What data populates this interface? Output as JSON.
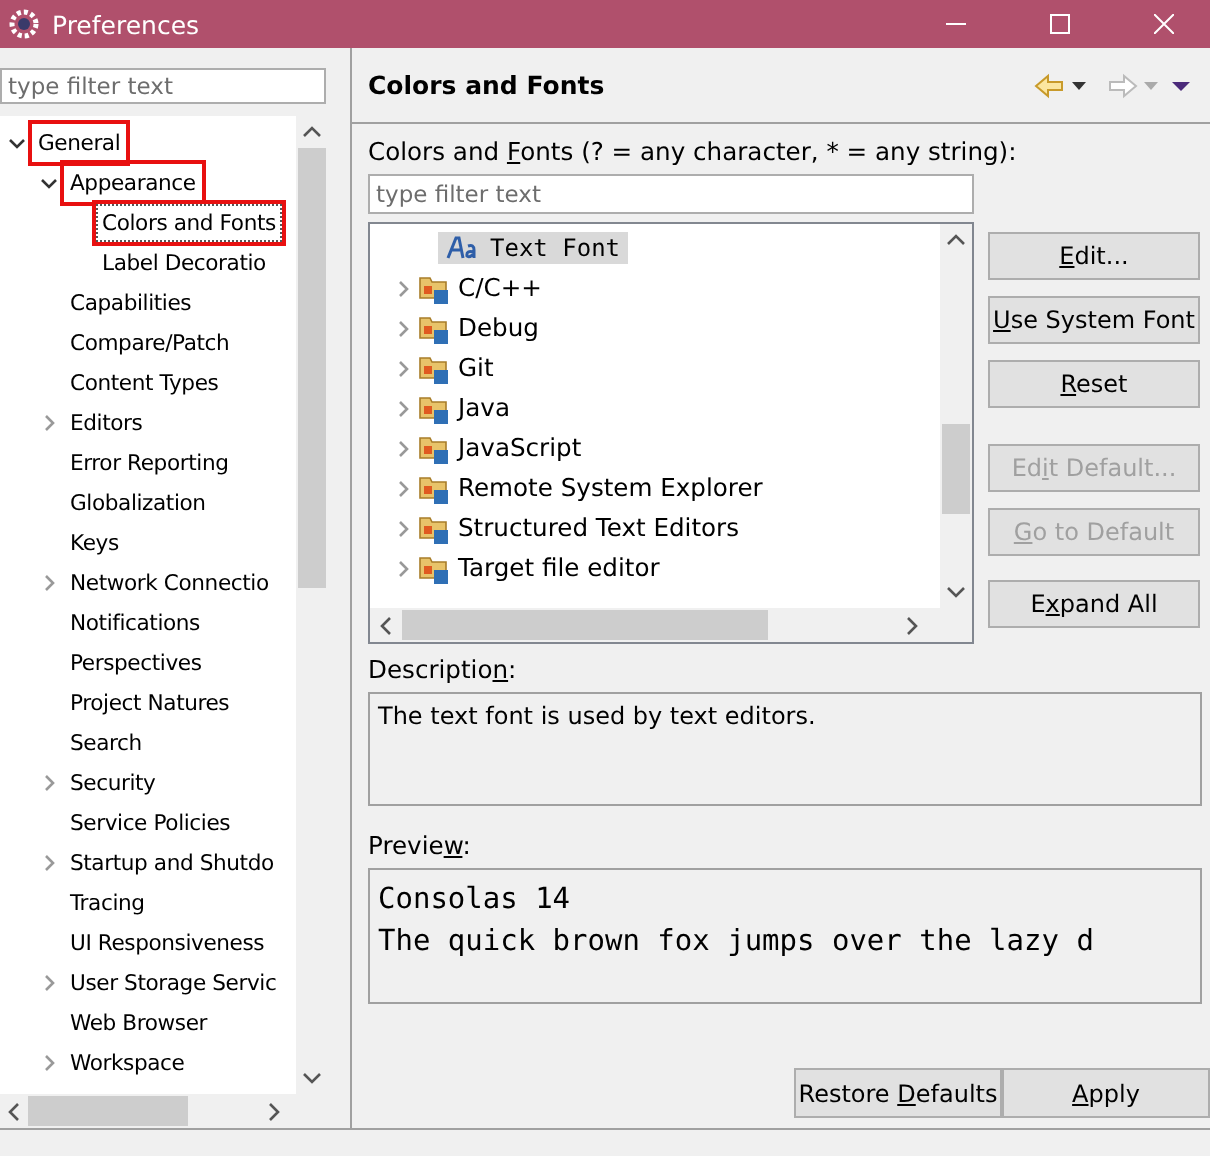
{
  "window": {
    "title": "Preferences"
  },
  "left_filter": {
    "placeholder": "type filter text"
  },
  "tree": [
    {
      "label": "General",
      "kind": "folder",
      "expanded": true,
      "selected": false,
      "annotated": true,
      "children": [
        {
          "label": "Appearance",
          "kind": "folder",
          "expanded": true,
          "selected": false,
          "annotated": true,
          "children": [
            {
              "label": "Colors and Fonts",
              "kind": "leaf",
              "selected": true,
              "annotated": true
            },
            {
              "label": "Label Decoratio",
              "kind": "leaf",
              "selected": false,
              "annotated": false
            }
          ]
        },
        {
          "label": "Capabilities",
          "kind": "leaf",
          "selected": false,
          "annotated": false
        },
        {
          "label": "Compare/Patch",
          "kind": "leaf",
          "selected": false,
          "annotated": false
        },
        {
          "label": "Content Types",
          "kind": "leaf",
          "selected": false,
          "annotated": false
        },
        {
          "label": "Editors",
          "kind": "folder",
          "expanded": false,
          "selected": false,
          "annotated": false
        },
        {
          "label": "Error Reporting",
          "kind": "leaf",
          "selected": false,
          "annotated": false
        },
        {
          "label": "Globalization",
          "kind": "leaf",
          "selected": false,
          "annotated": false
        },
        {
          "label": "Keys",
          "kind": "leaf",
          "selected": false,
          "annotated": false
        },
        {
          "label": "Network Connectio",
          "kind": "folder",
          "expanded": false,
          "selected": false,
          "annotated": false
        },
        {
          "label": "Notifications",
          "kind": "leaf",
          "selected": false,
          "annotated": false
        },
        {
          "label": "Perspectives",
          "kind": "leaf",
          "selected": false,
          "annotated": false
        },
        {
          "label": "Project Natures",
          "kind": "leaf",
          "selected": false,
          "annotated": false
        },
        {
          "label": "Search",
          "kind": "leaf",
          "selected": false,
          "annotated": false
        },
        {
          "label": "Security",
          "kind": "folder",
          "expanded": false,
          "selected": false,
          "annotated": false
        },
        {
          "label": "Service Policies",
          "kind": "leaf",
          "selected": false,
          "annotated": false
        },
        {
          "label": "Startup and Shutdo",
          "kind": "folder",
          "expanded": false,
          "selected": false,
          "annotated": false
        },
        {
          "label": "Tracing",
          "kind": "leaf",
          "selected": false,
          "annotated": false
        },
        {
          "label": "UI Responsiveness",
          "kind": "leaf",
          "selected": false,
          "annotated": false
        },
        {
          "label": "User Storage Servic",
          "kind": "folder",
          "expanded": false,
          "selected": false,
          "annotated": false
        },
        {
          "label": "Web Browser",
          "kind": "leaf",
          "selected": false,
          "annotated": false
        },
        {
          "label": "Workspace",
          "kind": "folder",
          "expanded": false,
          "selected": false,
          "annotated": false
        }
      ]
    }
  ],
  "page": {
    "title": "Colors and Fonts",
    "filter_label": {
      "before": "Colors and ",
      "key": "F",
      "after": "onts (? = any character, * = any string):"
    },
    "filter": {
      "placeholder": "type filter text"
    },
    "fonts": [
      {
        "label": "Text Font",
        "kind": "font",
        "selected": true
      },
      {
        "label": "C/C++",
        "kind": "category",
        "selected": false
      },
      {
        "label": "Debug",
        "kind": "category",
        "selected": false
      },
      {
        "label": "Git",
        "kind": "category",
        "selected": false
      },
      {
        "label": "Java",
        "kind": "category",
        "selected": false
      },
      {
        "label": "JavaScript",
        "kind": "category",
        "selected": false
      },
      {
        "label": "Remote System Explorer",
        "kind": "category",
        "selected": false
      },
      {
        "label": "Structured Text Editors",
        "kind": "category",
        "selected": false
      },
      {
        "label": "Target file editor",
        "kind": "category",
        "selected": false
      }
    ],
    "buttons": [
      {
        "key": "E",
        "after": "dit...",
        "disabled": false
      },
      {
        "key": "U",
        "after": "se System Font",
        "disabled": false
      },
      {
        "key": "R",
        "after": "eset",
        "disabled": false
      },
      {
        "before": "Ed",
        "key": "i",
        "after": "t Default...",
        "disabled": true
      },
      {
        "key": "G",
        "after": "o to Default",
        "disabled": true
      },
      {
        "before": "E",
        "key": "x",
        "after": "pand All",
        "disabled": false
      }
    ],
    "description_label": {
      "before": "Descriptio",
      "key": "n",
      "after": ":"
    },
    "description": "The text font is used by text editors.",
    "preview_label": {
      "before": "Previe",
      "key": "w",
      "after": ":"
    },
    "preview": [
      "Consolas 14",
      "The quick brown fox jumps over the lazy d"
    ]
  },
  "footer_buttons": [
    {
      "before": "Restore ",
      "key": "D",
      "after": "efaults"
    },
    {
      "key": "A",
      "after": "pply"
    }
  ]
}
